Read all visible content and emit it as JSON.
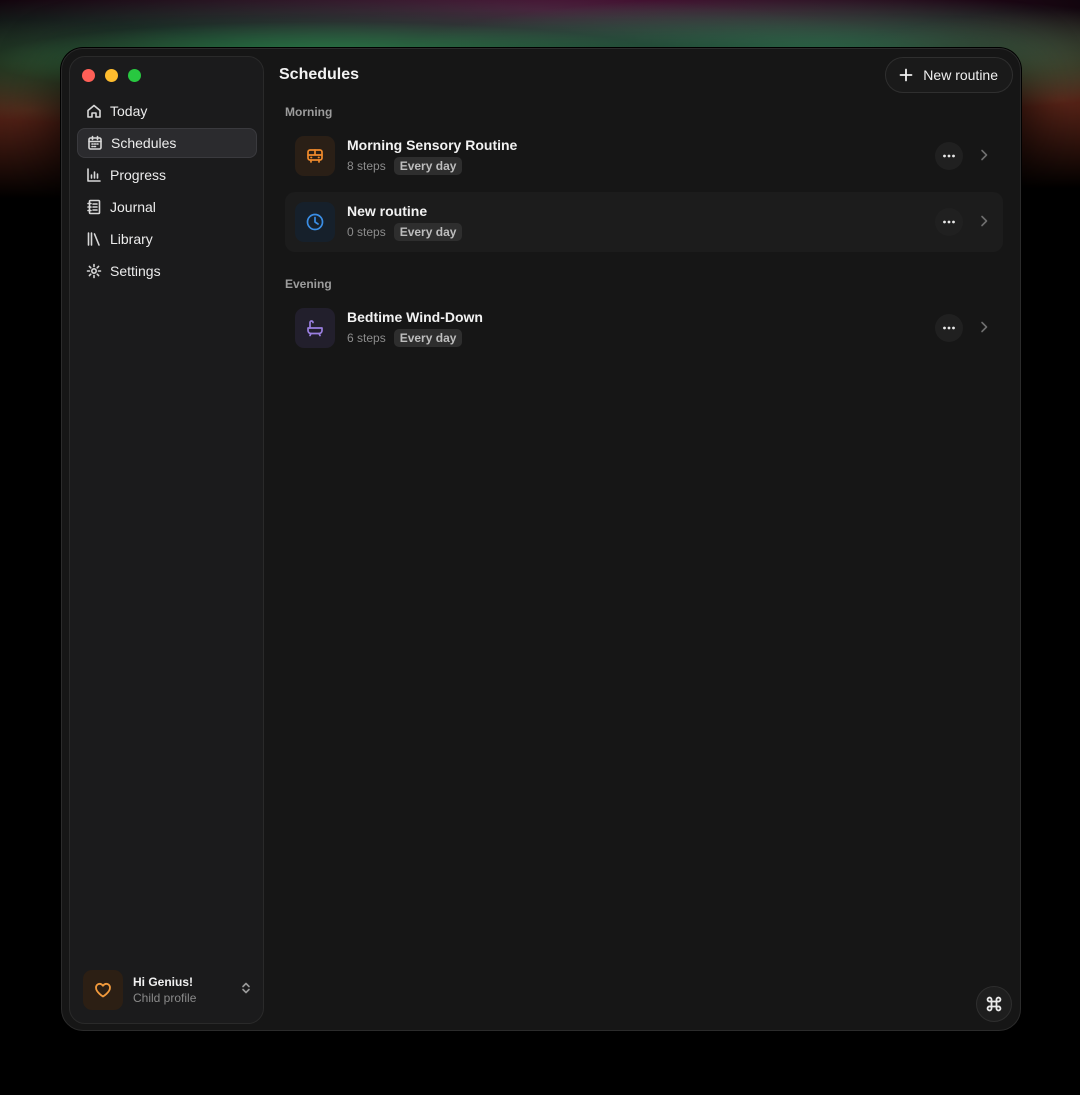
{
  "window": {
    "title": "Schedules"
  },
  "sidebar": {
    "items": [
      {
        "label": "Today",
        "icon": "home-icon"
      },
      {
        "label": "Schedules",
        "icon": "calendar-icon",
        "active": true
      },
      {
        "label": "Progress",
        "icon": "bar-chart-icon"
      },
      {
        "label": "Journal",
        "icon": "notebook-icon"
      },
      {
        "label": "Library",
        "icon": "library-icon"
      },
      {
        "label": "Settings",
        "icon": "gear-icon"
      }
    ],
    "profile": {
      "name": "Hi Genius!",
      "subtitle": "Child profile",
      "icon": "heart-icon"
    }
  },
  "header": {
    "new_button_label": "New routine"
  },
  "sections": [
    {
      "label": "Morning",
      "routines": [
        {
          "title": "Morning Sensory Routine",
          "steps": "8 steps",
          "frequency": "Every day",
          "icon": "bus-icon",
          "icon_color": "#f08a2c",
          "icon_bg": "#2a1f16"
        },
        {
          "title": "New routine",
          "steps": "0 steps",
          "frequency": "Every day",
          "icon": "clock-icon",
          "icon_color": "#3a8ee6",
          "icon_bg": "#16202b"
        }
      ]
    },
    {
      "label": "Evening",
      "routines": [
        {
          "title": "Bedtime Wind-Down",
          "steps": "6 steps",
          "frequency": "Every day",
          "icon": "bathtub-icon",
          "icon_color": "#9a7fe0",
          "icon_bg": "#221f2c"
        }
      ]
    }
  ],
  "colors": {
    "window_bg": "#161616",
    "sidebar_bg": "#1b1b1c",
    "accent_orange": "#f29a3c"
  }
}
